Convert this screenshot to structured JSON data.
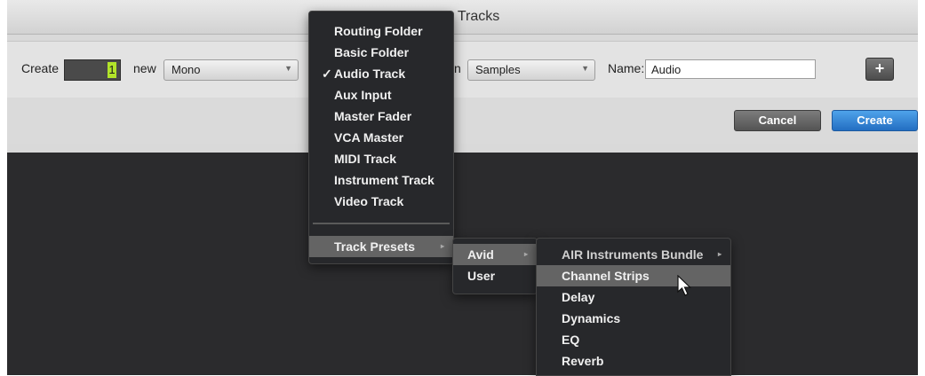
{
  "dialog": {
    "title": "New Tracks",
    "create_label": "Create",
    "count_value": "1",
    "new_label": "new",
    "format_value": "Mono",
    "timebase_label_fragment": "n",
    "timebase_value": "Samples",
    "name_label": "Name:",
    "name_value": "Audio",
    "add_row_button": "+",
    "cancel_button": "Cancel",
    "create_button": "Create"
  },
  "track_type_menu": {
    "items": [
      {
        "label": "Routing Folder",
        "checked": false
      },
      {
        "label": "Basic Folder",
        "checked": false
      },
      {
        "label": "Audio Track",
        "checked": true,
        "check_mark": "✓"
      },
      {
        "label": "Aux Input",
        "checked": false
      },
      {
        "label": "Master Fader",
        "checked": false
      },
      {
        "label": "VCA Master",
        "checked": false
      },
      {
        "label": "MIDI Track",
        "checked": false
      },
      {
        "label": "Instrument Track",
        "checked": false
      },
      {
        "label": "Video Track",
        "checked": false
      }
    ],
    "presets_item": "Track Presets"
  },
  "presets_submenu": {
    "items": [
      "Avid",
      "User"
    ],
    "highlighted": "Avid"
  },
  "avid_submenu": {
    "items": [
      "AIR Instruments Bundle",
      "Channel Strips",
      "Delay",
      "Dynamics",
      "EQ",
      "Reverb"
    ],
    "highlighted": "Channel Strips"
  },
  "colors": {
    "menu_bg": "#27282b",
    "menu_highlight": "#646464",
    "count_accent": "#b2e42a",
    "create_button": "#2f7fd6"
  }
}
